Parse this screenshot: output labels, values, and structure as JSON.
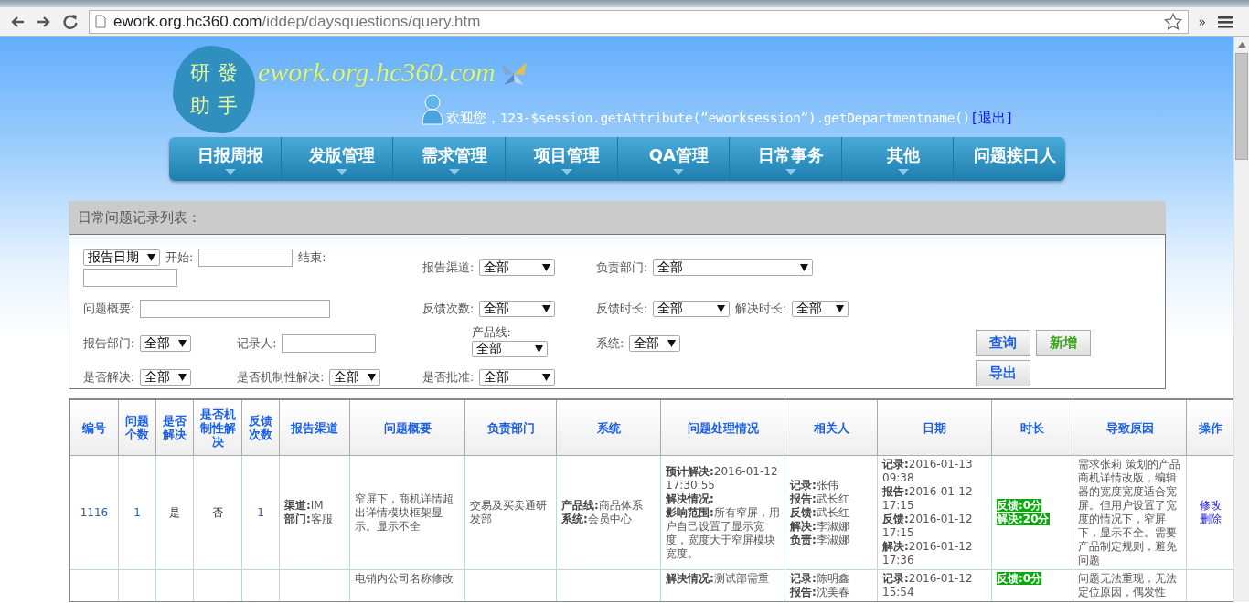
{
  "browser": {
    "url_host": "ework.org.hc360.com",
    "url_path": "/iddep/daysquestions/query.htm",
    "overflow": "»"
  },
  "header": {
    "logo_lines": [
      "研發",
      "助手"
    ],
    "site_name": "ework.org.hc360.com",
    "welcome": "欢迎您，123-$session.getAttribute(”eworksession”).getDepartmentname()",
    "logout": "[退出]"
  },
  "nav": [
    {
      "label": "日报周报",
      "has_menu": true
    },
    {
      "label": "发版管理",
      "has_menu": true
    },
    {
      "label": "需求管理",
      "has_menu": true
    },
    {
      "label": "项目管理",
      "has_menu": true
    },
    {
      "label": "QA管理",
      "has_menu": true
    },
    {
      "label": "日常事务",
      "has_menu": true
    },
    {
      "label": "其他",
      "has_menu": true
    },
    {
      "label": "问题接口人",
      "has_menu": false
    }
  ],
  "panel_title": "日常问题记录列表：",
  "filter_rows": [
    [
      [
        {
          "kind": "select",
          "value": "报告日期"
        },
        {
          "kind": "label",
          "text": "开始:"
        },
        {
          "kind": "input"
        },
        {
          "kind": "label",
          "text": "结束:"
        },
        {
          "kind": "input"
        }
      ],
      [
        {
          "kind": "label",
          "text": "报告渠道:"
        },
        {
          "kind": "select",
          "value": "全部"
        }
      ],
      [
        {
          "kind": "label",
          "text": "负责部门:"
        },
        {
          "kind": "select",
          "value": "全部"
        }
      ]
    ],
    [
      [
        {
          "kind": "label",
          "text": "问题概要:"
        },
        {
          "kind": "input"
        }
      ],
      [
        {
          "kind": "label",
          "text": "反馈次数:"
        },
        {
          "kind": "select",
          "value": "全部"
        }
      ],
      [
        {
          "kind": "label",
          "text": "反馈时长:"
        },
        {
          "kind": "select",
          "value": "全部"
        },
        {
          "kind": "label",
          "text": "解决时长:"
        },
        {
          "kind": "select",
          "value": "全部"
        }
      ]
    ],
    [
      [
        {
          "kind": "label",
          "text": "报告部门:"
        },
        {
          "kind": "select",
          "value": "全部"
        },
        {
          "kind": "gap"
        },
        {
          "kind": "label",
          "text": "记录人:"
        },
        {
          "kind": "input"
        }
      ],
      [
        {
          "kind": "label",
          "text": "产品线:"
        },
        {
          "kind": "select",
          "value": "全部"
        }
      ],
      [
        {
          "kind": "label",
          "text": "系统:"
        },
        {
          "kind": "select",
          "value": "全部"
        }
      ]
    ],
    [
      [
        {
          "kind": "label",
          "text": "是否解决:"
        },
        {
          "kind": "select",
          "value": "全部"
        },
        {
          "kind": "gap"
        },
        {
          "kind": "label",
          "text": "是否机制性解决:"
        },
        {
          "kind": "select",
          "value": "全部"
        }
      ],
      [
        {
          "kind": "label",
          "text": "是否批准:"
        },
        {
          "kind": "select",
          "value": "全部"
        }
      ],
      []
    ]
  ],
  "buttons": [
    {
      "label": "查询",
      "color": "#1a5fe6"
    },
    {
      "label": "新增",
      "color": "#3aa61a"
    },
    {
      "label": "导出",
      "color": "#1a5fe6"
    }
  ],
  "table": {
    "columns": [
      "编号",
      "问题个数",
      "是否解决",
      "是否机制性解决",
      "反馈次数",
      "报告渠道",
      "问题概要",
      "负责部门",
      "系统",
      "问题处理情况",
      "相关人",
      "日期",
      "时长",
      "导致原因",
      "操作"
    ],
    "rows": [
      {
        "id": "1116",
        "count": "1",
        "solved": "是",
        "mechanism": "否",
        "feedback_count": "1",
        "channel": [
          "**渠道:**IM",
          "**部门:**客服"
        ],
        "summary": [
          "窄屏下，商机详情超出详情模块框架显示。显示不全"
        ],
        "department": [
          "交易及买卖通研发部"
        ],
        "system": [
          "**产品线:**商品体系",
          "**系统:**会员中心"
        ],
        "handling": [
          "**预计解决:**2016-01-12 17:30:55",
          "**解决情况:**",
          "**影响范围:**所有窄屏，用户自己设置了显示宽度，宽度大于窄屏模块宽度。"
        ],
        "people": [
          "**记录:**张伟",
          "**报告:**武长红",
          "**反馈:**武长红",
          "**解决:**李淑娜",
          "**负责:**李淑娜"
        ],
        "dates": [
          "**记录:**2016-01-13 09:38",
          "**报告:**2016-01-12 17:15",
          "**反馈:**2016-01-12 17:15",
          "**解决:**2016-01-12 17:36"
        ],
        "duration": [
          "反馈:0分",
          "解决:20分"
        ],
        "cause": [
          "需求张莉 策划的产品商机详情改版，编辑器的宽度宽度适合宽屏。但用户设置了宽度的情况下，窄屏下，显示不全。需要产品制定规则，避免问题"
        ],
        "actions": [
          "修改",
          "删除"
        ]
      },
      {
        "id": "",
        "count": "",
        "solved": "",
        "mechanism": "",
        "feedback_count": "",
        "channel": [],
        "summary": [
          "电销内公司名称修改"
        ],
        "department": [],
        "system": [],
        "handling": [
          "**解决情况:**测试部需重"
        ],
        "people": [
          "**记录:**陈明鑫",
          "**报告:**沈美春"
        ],
        "dates": [
          "**记录:**2016-01-12 15:54"
        ],
        "duration": [
          "反馈:0分"
        ],
        "cause": [
          "问题无法重现，无法定位原因，偶发性"
        ],
        "actions": []
      }
    ]
  }
}
